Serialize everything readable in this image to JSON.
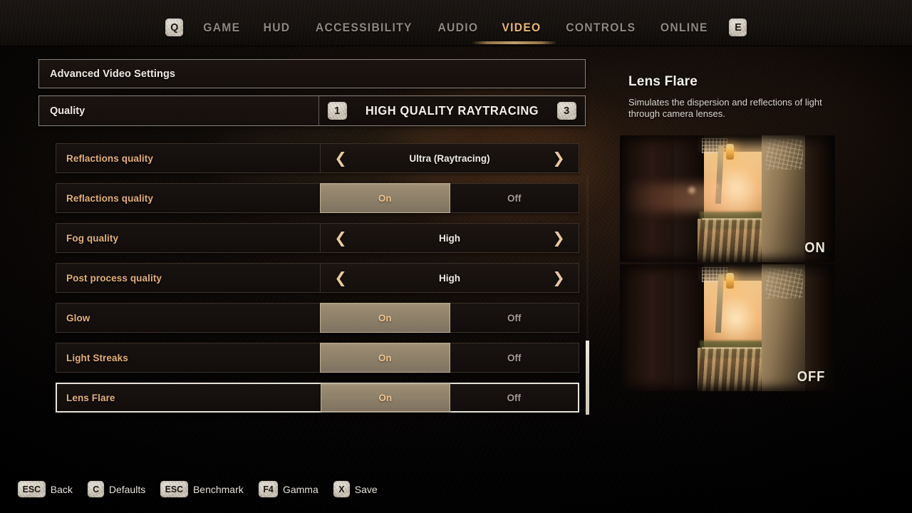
{
  "topbar": {
    "prev_key": "Q",
    "next_key": "E",
    "tabs": [
      {
        "label": "GAME",
        "active": false
      },
      {
        "label": "HUD",
        "active": false
      },
      {
        "label": "ACCESSIBILITY",
        "active": false
      },
      {
        "label": "AUDIO",
        "active": false
      },
      {
        "label": "VIDEO",
        "active": true
      },
      {
        "label": "CONTROLS",
        "active": false
      },
      {
        "label": "ONLINE",
        "active": false
      }
    ]
  },
  "panel": {
    "section_header": "Advanced Video Settings",
    "quality": {
      "label": "Quality",
      "value": "HIGH QUALITY RAYTRACING",
      "prev_key": "1",
      "next_key": "3"
    },
    "rows": [
      {
        "label": "Reflactions quality",
        "type": "stepper",
        "value": "Ultra (Raytracing)",
        "selected": false
      },
      {
        "label": "Reflactions quality",
        "type": "toggle",
        "value": "On",
        "selected": false
      },
      {
        "label": "Fog quality",
        "type": "stepper",
        "value": "High",
        "selected": false
      },
      {
        "label": "Post process quality",
        "type": "stepper",
        "value": "High",
        "selected": false
      },
      {
        "label": "Glow",
        "type": "toggle",
        "value": "On",
        "selected": false
      },
      {
        "label": "Light Streaks",
        "type": "toggle",
        "value": "On",
        "selected": false
      },
      {
        "label": "Lens Flare",
        "type": "toggle",
        "value": "On",
        "selected": true
      }
    ],
    "toggle_on_label": "On",
    "toggle_off_label": "Off",
    "chevron_left": "❮",
    "chevron_right": "❯"
  },
  "info": {
    "title": "Lens Flare",
    "description": "Simulates the dispersion and reflections of light through camera lenses.",
    "preview_on_tag": "ON",
    "preview_off_tag": "OFF"
  },
  "footer": [
    {
      "key": "ESC",
      "label": "Back"
    },
    {
      "key": "C",
      "label": "Defaults"
    },
    {
      "key": "ESC",
      "label": "Benchmark"
    },
    {
      "key": "F4",
      "label": "Gamma"
    },
    {
      "key": "X",
      "label": "Save"
    }
  ],
  "colors": {
    "accent": "#e8b476",
    "label_text": "#e3b07a",
    "toggle_on_bg": "#8d8069",
    "selected_border": "#e9e4da"
  }
}
